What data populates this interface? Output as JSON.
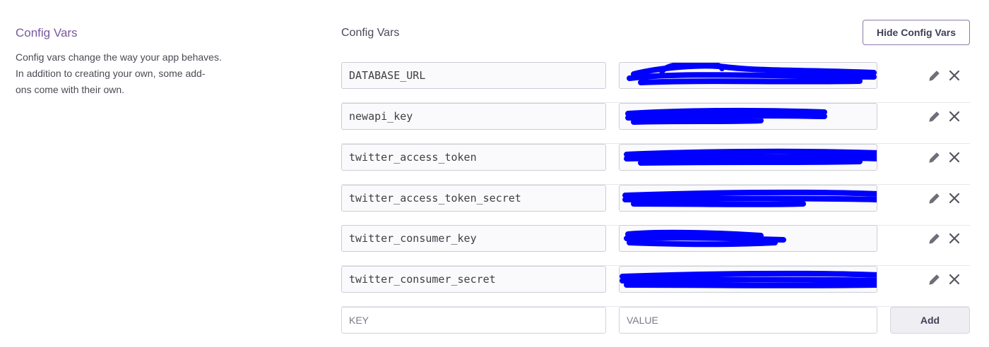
{
  "sidebar": {
    "title": "Config Vars",
    "description_lines": [
      "Config vars change the way your app behaves.",
      "In addition to creating your own, some add-",
      "ons come with their own."
    ]
  },
  "main": {
    "title": "Config Vars",
    "hide_button_label": "Hide Config Vars",
    "vars": [
      {
        "key": "DATABASE_URL"
      },
      {
        "key": "newapi_key"
      },
      {
        "key": "twitter_access_token"
      },
      {
        "key": "twitter_access_token_secret"
      },
      {
        "key": "twitter_consumer_key"
      },
      {
        "key": "twitter_consumer_secret"
      }
    ],
    "new_var": {
      "key_placeholder": "KEY",
      "value_placeholder": "VALUE",
      "add_label": "Add"
    }
  },
  "colors": {
    "accent": "#79589f",
    "redaction": "#0000ff",
    "icon": "#6f6f7a"
  },
  "icons": {
    "edit": "pencil-icon",
    "delete": "close-icon"
  }
}
